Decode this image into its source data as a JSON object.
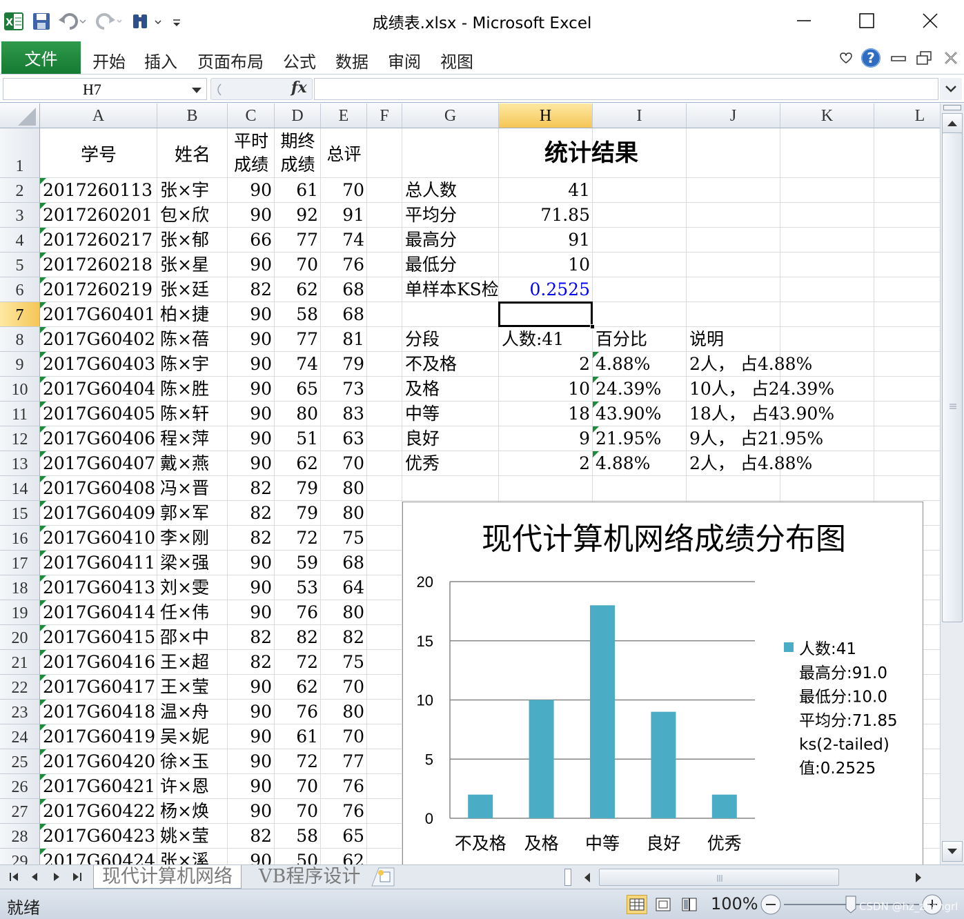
{
  "window": {
    "title": "成绩表.xlsx - Microsoft Excel"
  },
  "ribbon": {
    "file_label": "文件",
    "tabs": [
      "开始",
      "插入",
      "页面布局",
      "公式",
      "数据",
      "审阅",
      "视图"
    ]
  },
  "formula_bar": {
    "name_box": "H7",
    "fx_label": "fx",
    "formula": ""
  },
  "grid": {
    "columns": [
      "A",
      "B",
      "C",
      "D",
      "E",
      "F",
      "G",
      "H",
      "I",
      "J",
      "K",
      "L"
    ],
    "selected_column": "H",
    "selected_row": 7,
    "selected_cell": "H7",
    "header_row": {
      "id_label": "学号",
      "name_label": "姓名",
      "regular_label_1": "平时",
      "regular_label_2": "成绩",
      "final_label_1": "期终",
      "final_label_2": "成绩",
      "total_label": "总评",
      "stats_title": "统计结果"
    },
    "students": [
      [
        "2017260113",
        "张×宇",
        "90",
        "61",
        "70"
      ],
      [
        "2017260201",
        "包×欣",
        "90",
        "92",
        "91"
      ],
      [
        "2017260217",
        "张×郁",
        "66",
        "77",
        "74"
      ],
      [
        "2017260218",
        "张×星",
        "90",
        "70",
        "76"
      ],
      [
        "2017260219",
        "张×廷",
        "82",
        "62",
        "68"
      ],
      [
        "2017G60401",
        "柏×捷",
        "90",
        "58",
        "68"
      ],
      [
        "2017G60402",
        "陈×蓓",
        "90",
        "77",
        "81"
      ],
      [
        "2017G60403",
        "陈×宇",
        "90",
        "74",
        "79"
      ],
      [
        "2017G60404",
        "陈×胜",
        "90",
        "65",
        "73"
      ],
      [
        "2017G60405",
        "陈×轩",
        "90",
        "80",
        "83"
      ],
      [
        "2017G60406",
        "程×萍",
        "90",
        "51",
        "63"
      ],
      [
        "2017G60407",
        "戴×燕",
        "90",
        "62",
        "70"
      ],
      [
        "2017G60408",
        "冯×晋",
        "82",
        "79",
        "80"
      ],
      [
        "2017G60409",
        "郭×军",
        "82",
        "79",
        "80"
      ],
      [
        "2017G60410",
        "李×刚",
        "82",
        "72",
        "75"
      ],
      [
        "2017G60411",
        "梁×强",
        "90",
        "59",
        "68"
      ],
      [
        "2017G60413",
        "刘×雯",
        "90",
        "53",
        "64"
      ],
      [
        "2017G60414",
        "任×伟",
        "90",
        "76",
        "80"
      ],
      [
        "2017G60415",
        "邵×中",
        "82",
        "82",
        "82"
      ],
      [
        "2017G60416",
        "王×超",
        "82",
        "72",
        "75"
      ],
      [
        "2017G60417",
        "王×莹",
        "90",
        "62",
        "70"
      ],
      [
        "2017G60418",
        "温×舟",
        "90",
        "76",
        "80"
      ],
      [
        "2017G60419",
        "吴×妮",
        "90",
        "61",
        "70"
      ],
      [
        "2017G60420",
        "徐×玉",
        "90",
        "72",
        "77"
      ],
      [
        "2017G60421",
        "许×恩",
        "90",
        "70",
        "76"
      ],
      [
        "2017G60422",
        "杨×焕",
        "90",
        "70",
        "76"
      ],
      [
        "2017G60423",
        "姚×莹",
        "82",
        "58",
        "65"
      ],
      [
        "2017G60424",
        "张×溪",
        "90",
        "50",
        "62"
      ]
    ],
    "summary": [
      {
        "label": "总人数",
        "value": "41"
      },
      {
        "label": "平均分",
        "value": "71.85"
      },
      {
        "label": "最高分",
        "value": "91"
      },
      {
        "label": "最低分",
        "value": "10"
      },
      {
        "label": "单样本KS检",
        "value": "0.2525"
      }
    ],
    "distribution_header": {
      "segment": "分段",
      "count": "人数:41",
      "percent": "百分比",
      "note": "说明"
    },
    "distribution": [
      {
        "segment": "不及格",
        "count": "2",
        "percent": "4.88%",
        "note": "2人， 占4.88%"
      },
      {
        "segment": "及格",
        "count": "10",
        "percent": "24.39%",
        "note": "10人， 占24.39%"
      },
      {
        "segment": "中等",
        "count": "18",
        "percent": "43.90%",
        "note": "18人， 占43.90%"
      },
      {
        "segment": "良好",
        "count": "9",
        "percent": "21.95%",
        "note": "9人， 占21.95%"
      },
      {
        "segment": "优秀",
        "count": "2",
        "percent": "4.88%",
        "note": "2人， 占4.88%"
      }
    ],
    "colors": {
      "selection_highlight": "#f5c656",
      "grid_line": "#dadcdd",
      "file_tab": "#1f7a3a",
      "ks_value": "#0000ff",
      "error_triangle": "#1e8a3c"
    }
  },
  "chart_data": {
    "type": "bar",
    "title": "现代计算机网络成绩分布图",
    "categories": [
      "不及格",
      "及格",
      "中等",
      "良好",
      "优秀"
    ],
    "series": [
      {
        "name": "人数:41",
        "values": [
          2,
          10,
          18,
          9,
          2
        ],
        "color": "#4bacc6"
      }
    ],
    "legend_extra": [
      "最高分:91.0",
      "最低分:10.0",
      "平均分:71.85",
      "ks(2-tailed)",
      "值:0.2525"
    ],
    "legend_position": "right",
    "ylim": [
      0,
      20
    ],
    "yticks": [
      "0",
      "5",
      "10",
      "15",
      "20"
    ],
    "grid": true,
    "xlabel": "",
    "ylabel": ""
  },
  "sheet_tabs": {
    "tabs": [
      "现代计算机网络",
      "VB程序设计"
    ],
    "active": "现代计算机网络"
  },
  "status_bar": {
    "status": "就绪",
    "zoom": "100%",
    "watermark": "CSDN @hz_zhangrl"
  }
}
